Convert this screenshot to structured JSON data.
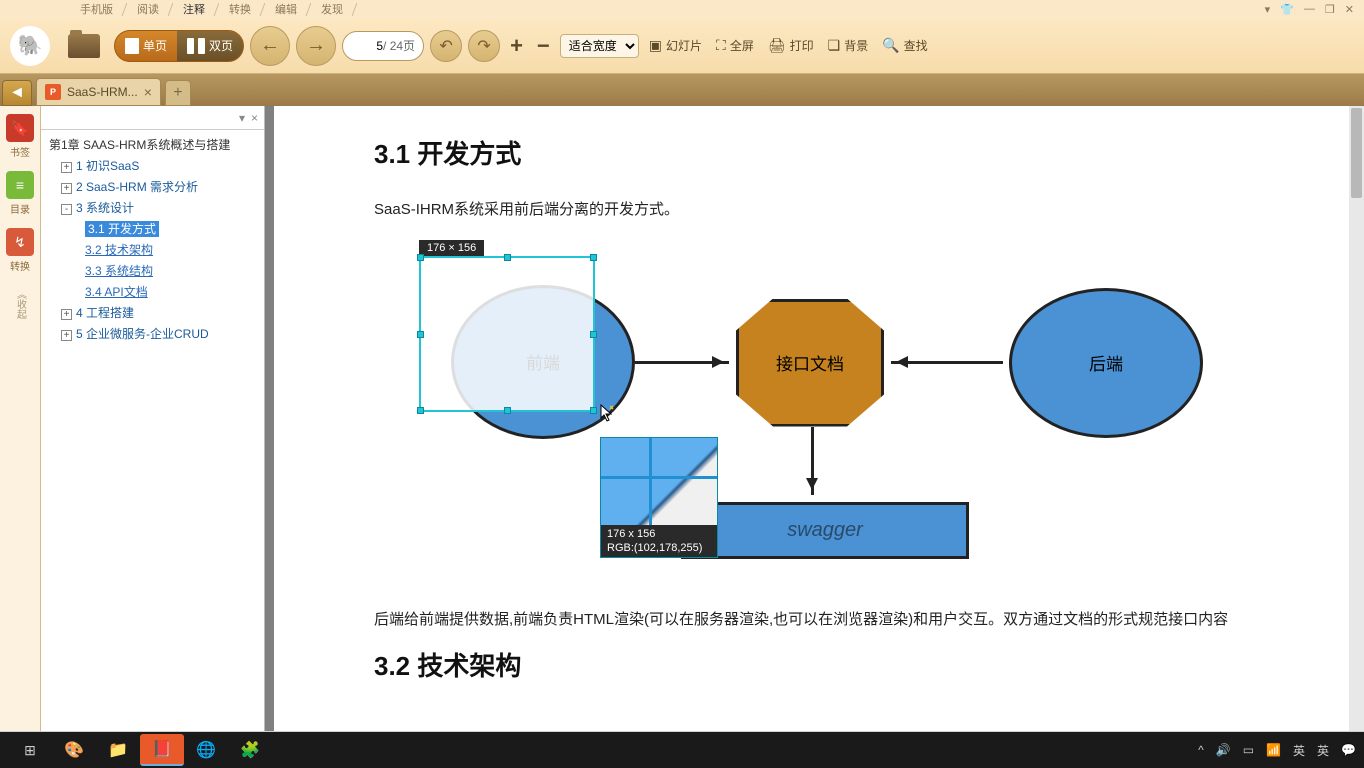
{
  "menu": {
    "items": [
      "手机版",
      "阅读",
      "注释",
      "转换",
      "编辑",
      "发现"
    ],
    "active_index": 2
  },
  "toolbar": {
    "single_page": "单页",
    "double_page": "双页",
    "page_current": "5",
    "page_total": "/ 24页",
    "zoom_mode": "适合宽度",
    "slideshow": "幻灯片",
    "fullscreen": "全屏",
    "print": "打印",
    "background": "背景",
    "search": "查找"
  },
  "tab": {
    "title": "SaaS-HRM..."
  },
  "rail": {
    "bookmarks": "书签",
    "toc": "目录",
    "convert": "转换",
    "collapse": "《收起"
  },
  "tree": {
    "root": "第1章 SAAS-HRM系统概述与搭建",
    "items": [
      {
        "label": "1 初识SaaS",
        "lvl": 1,
        "exp": "+"
      },
      {
        "label": "2 SaaS-HRM 需求分析",
        "lvl": 1,
        "exp": "+"
      },
      {
        "label": "3 系统设计",
        "lvl": 1,
        "exp": "-"
      },
      {
        "label": "3.1 开发方式",
        "lvl": 2,
        "selected": true
      },
      {
        "label": "3.2 技术架构",
        "lvl": 2,
        "link": true
      },
      {
        "label": "3.3 系统结构",
        "lvl": 2,
        "link": true
      },
      {
        "label": "3.4 API文档",
        "lvl": 2,
        "link": true
      },
      {
        "label": "4 工程搭建",
        "lvl": 1,
        "exp": "+"
      },
      {
        "label": "5 企业微服务-企业CRUD",
        "lvl": 1,
        "exp": "+"
      }
    ]
  },
  "doc": {
    "h1": "3.1 开发方式",
    "p1": "SaaS-IHRM系统采用前后端分离的开发方式。",
    "node_front": "前端",
    "node_api": "接口文档",
    "node_back": "后端",
    "node_swagger": "swagger",
    "p2": "后端给前端提供数据,前端负责HTML渲染(可以在服务器渲染,也可以在浏览器渲染)和用户交互。双方通过文档的形式规范接口内容",
    "h2": "3.2 技术架构"
  },
  "selection": {
    "size": "176 × 156",
    "mag_size": "176 x 156",
    "mag_rgb": "RGB:(102,178,255)"
  },
  "tray": {
    "ime1": "英",
    "ime2": "英"
  }
}
